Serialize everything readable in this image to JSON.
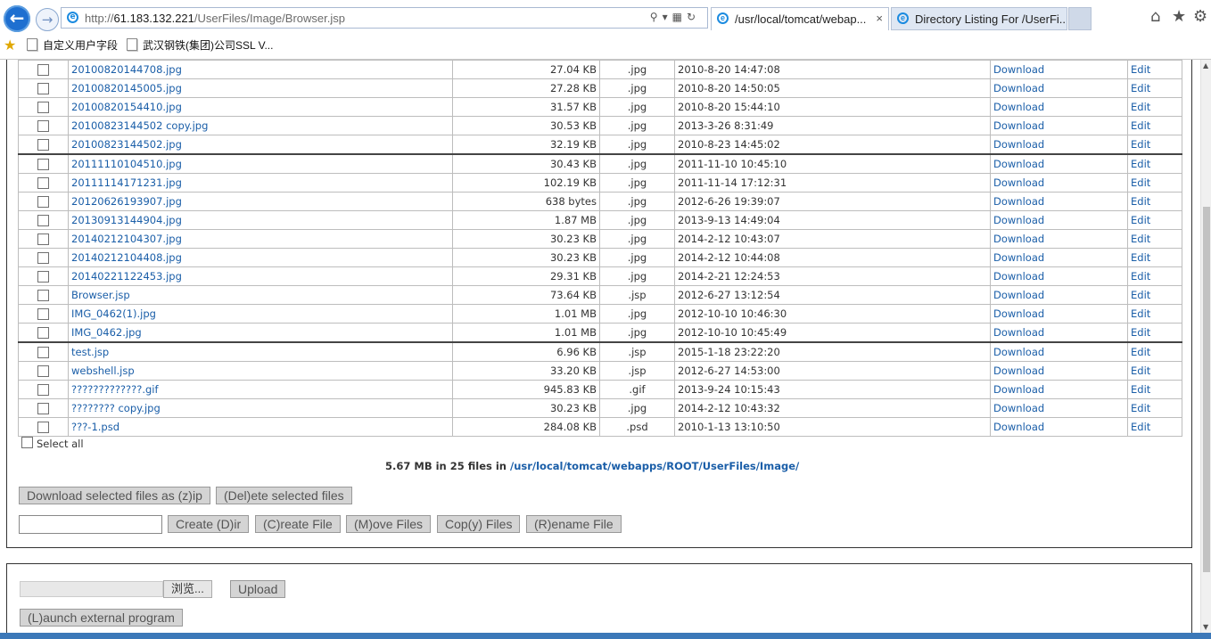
{
  "browser": {
    "url_prefix": "http://",
    "url_host": "61.183.132.221",
    "url_path": "/UserFiles/Image/Browser.jsp",
    "tabs": [
      {
        "label": "/usr/local/tomcat/webap...",
        "close": "×"
      },
      {
        "label": "Directory Listing For /UserFi..."
      }
    ],
    "favorites": [
      {
        "label": "自定义用户字段"
      },
      {
        "label": "武汉钢铁(集团)公司SSL V..."
      }
    ]
  },
  "files": [
    {
      "name": "20100820144708.jpg",
      "size": "27.04 KB",
      "type": ".jpg",
      "date": "2010-8-20 14:47:08"
    },
    {
      "name": "20100820145005.jpg",
      "size": "27.28 KB",
      "type": ".jpg",
      "date": "2010-8-20 14:50:05"
    },
    {
      "name": "20100820154410.jpg",
      "size": "31.57 KB",
      "type": ".jpg",
      "date": "2010-8-20 15:44:10"
    },
    {
      "name": "20100823144502 copy.jpg",
      "size": "30.53 KB",
      "type": ".jpg",
      "date": "2013-3-26 8:31:49"
    },
    {
      "name": "20100823144502.jpg",
      "size": "32.19 KB",
      "type": ".jpg",
      "date": "2010-8-23 14:45:02"
    },
    {
      "name": "20111110104510.jpg",
      "size": "30.43 KB",
      "type": ".jpg",
      "date": "2011-11-10 10:45:10"
    },
    {
      "name": "20111114171231.jpg",
      "size": "102.19 KB",
      "type": ".jpg",
      "date": "2011-11-14 17:12:31"
    },
    {
      "name": "20120626193907.jpg",
      "size": "638 bytes",
      "type": ".jpg",
      "date": "2012-6-26 19:39:07"
    },
    {
      "name": "20130913144904.jpg",
      "size": "1.87 MB",
      "type": ".jpg",
      "date": "2013-9-13 14:49:04"
    },
    {
      "name": "20140212104307.jpg",
      "size": "30.23 KB",
      "type": ".jpg",
      "date": "2014-2-12 10:43:07"
    },
    {
      "name": "20140212104408.jpg",
      "size": "30.23 KB",
      "type": ".jpg",
      "date": "2014-2-12 10:44:08"
    },
    {
      "name": "20140221122453.jpg",
      "size": "29.31 KB",
      "type": ".jpg",
      "date": "2014-2-21 12:24:53"
    },
    {
      "name": "Browser.jsp",
      "size": "73.64 KB",
      "type": ".jsp",
      "date": "2012-6-27 13:12:54"
    },
    {
      "name": "IMG_0462(1).jpg",
      "size": "1.01 MB",
      "type": ".jpg",
      "date": "2012-10-10 10:46:30"
    },
    {
      "name": "IMG_0462.jpg",
      "size": "1.01 MB",
      "type": ".jpg",
      "date": "2012-10-10 10:45:49"
    },
    {
      "name": "test.jsp",
      "size": "6.96 KB",
      "type": ".jsp",
      "date": "2015-1-18 23:22:20"
    },
    {
      "name": "webshell.jsp",
      "size": "33.20 KB",
      "type": ".jsp",
      "date": "2012-6-27 14:53:00"
    },
    {
      "name": "?????????????.gif",
      "size": "945.83 KB",
      "type": ".gif",
      "date": "2013-9-24 10:15:43"
    },
    {
      "name": "???????? copy.jpg",
      "size": "30.23 KB",
      "type": ".jpg",
      "date": "2014-2-12 10:43:32"
    },
    {
      "name": "???-1.psd",
      "size": "284.08 KB",
      "type": ".psd",
      "date": "2010-1-13 13:10:50"
    }
  ],
  "row_actions": {
    "download": "Download",
    "edit": "Edit"
  },
  "select_all": "Select all",
  "summary": {
    "text": "5.67 MB in 25 files in",
    "path": "/usr/local/tomcat/webapps/ROOT/UserFiles/Image/"
  },
  "buttons": {
    "download_zip": "Download selected files as (z)ip",
    "delete_selected": "(Del)ete selected files",
    "create_dir": "Create (D)ir",
    "create_file": "(C)reate File",
    "move_files": "(M)ove Files",
    "copy_files": "Cop(y) Files",
    "rename_file": "(R)ename File",
    "browse": "浏览...",
    "upload": "Upload",
    "launch": "(L)aunch external program"
  },
  "name_input_value": ""
}
